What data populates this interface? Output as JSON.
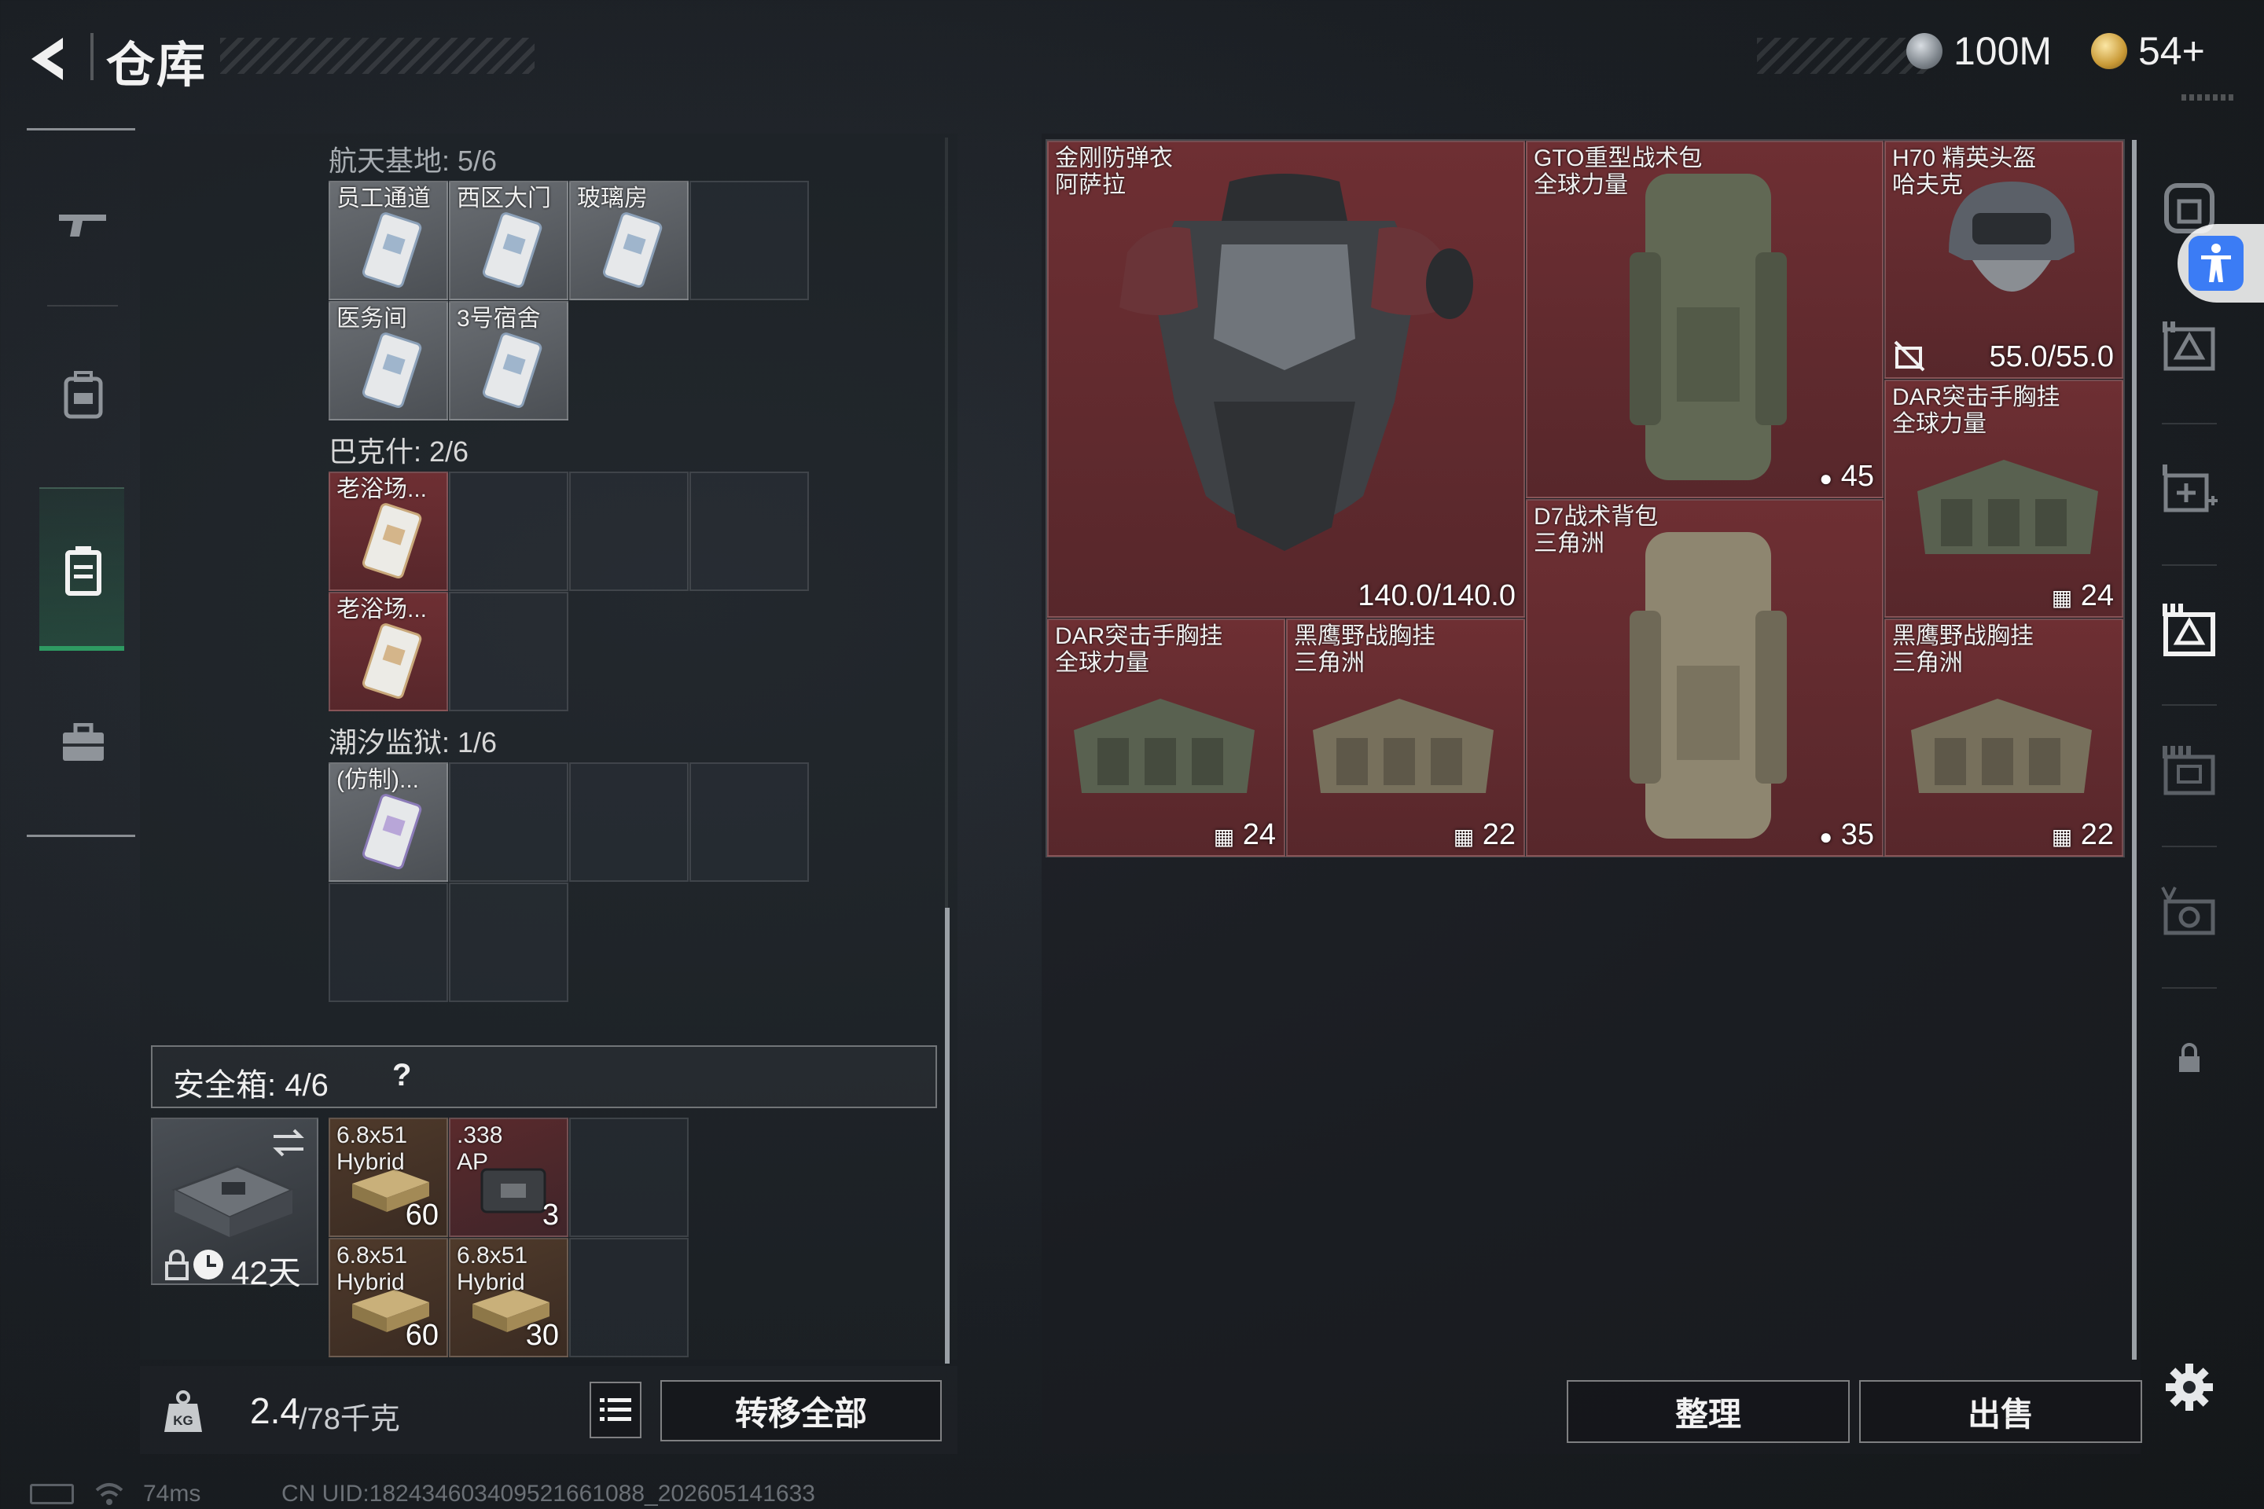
{
  "header": {
    "title": "仓库",
    "currency_primary": "100M",
    "currency_secondary": "54+"
  },
  "left_nav": {
    "items": [
      {
        "name": "weapons-tab",
        "icon": "gun-icon"
      },
      {
        "name": "backpack-tab",
        "icon": "backpack-icon"
      },
      {
        "name": "container-tab",
        "icon": "container-icon",
        "active": true
      },
      {
        "name": "briefcase-tab",
        "icon": "briefcase-icon"
      }
    ]
  },
  "key_sections": [
    {
      "title": "航天基地: 5/6",
      "items": [
        "员工通道",
        "西区大门",
        "玻璃房",
        "医务间",
        "3号宿舍"
      ]
    },
    {
      "title": "巴克什: 2/6",
      "items": [
        "老浴场...",
        "老浴场..."
      ]
    },
    {
      "title": "潮汐监狱: 1/6",
      "items": [
        "(仿制)..."
      ]
    }
  ],
  "safe_box": {
    "label": "安全箱: 4/6",
    "help": "?",
    "duration": "42天",
    "ammo": [
      {
        "line1": "6.8x51",
        "line2": "Hybrid",
        "count": "60"
      },
      {
        "line1": ".338",
        "line2": "AP",
        "count": "3"
      },
      {
        "line1": "6.8x51",
        "line2": "Hybrid",
        "count": "60"
      },
      {
        "line1": "6.8x51",
        "line2": "Hybrid",
        "count": "30"
      }
    ]
  },
  "bottom_left": {
    "weight_current": "2.4",
    "weight_max": "/78千克",
    "kg_label": "KG",
    "transfer_all": "转移全部"
  },
  "stash_items": {
    "armor": {
      "line1": "金刚防弹衣",
      "line2": "阿萨拉",
      "durability": "140.0/140.0"
    },
    "gto_bag": {
      "line1": "GTO重型战术包",
      "line2": "全球力量",
      "capacity": "45"
    },
    "helmet": {
      "line1": "H70 精英头盔",
      "line2": "哈夫克",
      "durability": "55.0/55.0"
    },
    "dar_rig_top": {
      "line1": "DAR突击手胸挂",
      "line2": "全球力量",
      "capacity": "24"
    },
    "d7_bag": {
      "line1": "D7战术背包",
      "line2": "三角洲",
      "capacity": "35"
    },
    "dar_rig_bottom": {
      "line1": "DAR突击手胸挂",
      "line2": "全球力量",
      "capacity": "24"
    },
    "heiying_rig_1": {
      "line1": "黑鹰野战胸挂",
      "line2": "三角洲",
      "capacity": "22"
    },
    "heiying_rig_2": {
      "line1": "黑鹰野战胸挂",
      "line2": "三角洲",
      "capacity": "22"
    }
  },
  "bottom_right": {
    "sort": "整理",
    "sell": "出售"
  },
  "status_bar": {
    "ping": "74ms",
    "uid": "CN UID:1824346034095216610​88_202605141633"
  },
  "colors": {
    "background": "#1b1f24",
    "equipment_red": "#5e2a2e",
    "accent_green": "#2e9a62",
    "accessibility_blue": "#3b7cf5"
  }
}
